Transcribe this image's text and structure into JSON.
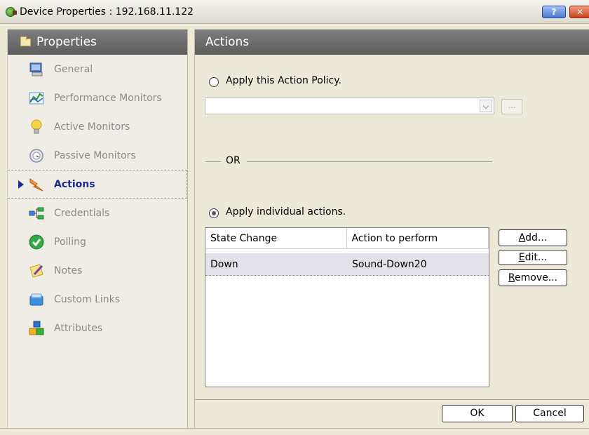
{
  "window": {
    "title": "Device Properties : 192.168.11.122",
    "help_label": "?",
    "close_label": "✕"
  },
  "sidebar": {
    "header": "Properties",
    "items": [
      {
        "label": "General",
        "icon": "computer-icon"
      },
      {
        "label": "Performance Monitors",
        "icon": "chart-icon"
      },
      {
        "label": "Active Monitors",
        "icon": "lightbulb-icon"
      },
      {
        "label": "Passive Monitors",
        "icon": "monitor-dial-icon"
      },
      {
        "label": "Actions",
        "icon": "lightning-icon",
        "selected": true
      },
      {
        "label": "Credentials",
        "icon": "network-link-icon"
      },
      {
        "label": "Polling",
        "icon": "checkmark-icon"
      },
      {
        "label": "Notes",
        "icon": "note-pencil-icon"
      },
      {
        "label": "Custom Links",
        "icon": "folder-link-icon"
      },
      {
        "label": "Attributes",
        "icon": "blocks-icon"
      }
    ]
  },
  "main": {
    "header": "Actions",
    "apply_policy_label": "Apply this Action Policy.",
    "policy_value": "",
    "browse_label": "...",
    "or_label": "OR",
    "apply_individual_label": "Apply individual actions.",
    "columns": [
      "State Change",
      "Action to perform"
    ],
    "rows": [
      {
        "state": "Down",
        "action": "Sound-Down20"
      }
    ],
    "buttons": {
      "add": {
        "underlined": "A",
        "rest": "dd..."
      },
      "edit": {
        "underlined": "E",
        "rest": "dit..."
      },
      "remove": {
        "underlined": "R",
        "rest": "emove..."
      }
    }
  },
  "footer": {
    "ok_label": "OK",
    "cancel_label": "Cancel"
  },
  "colors": {
    "header_gray": "#6d6d6d",
    "selected_text": "#1a2b8c",
    "dialog_bg": "#ece9d8"
  }
}
